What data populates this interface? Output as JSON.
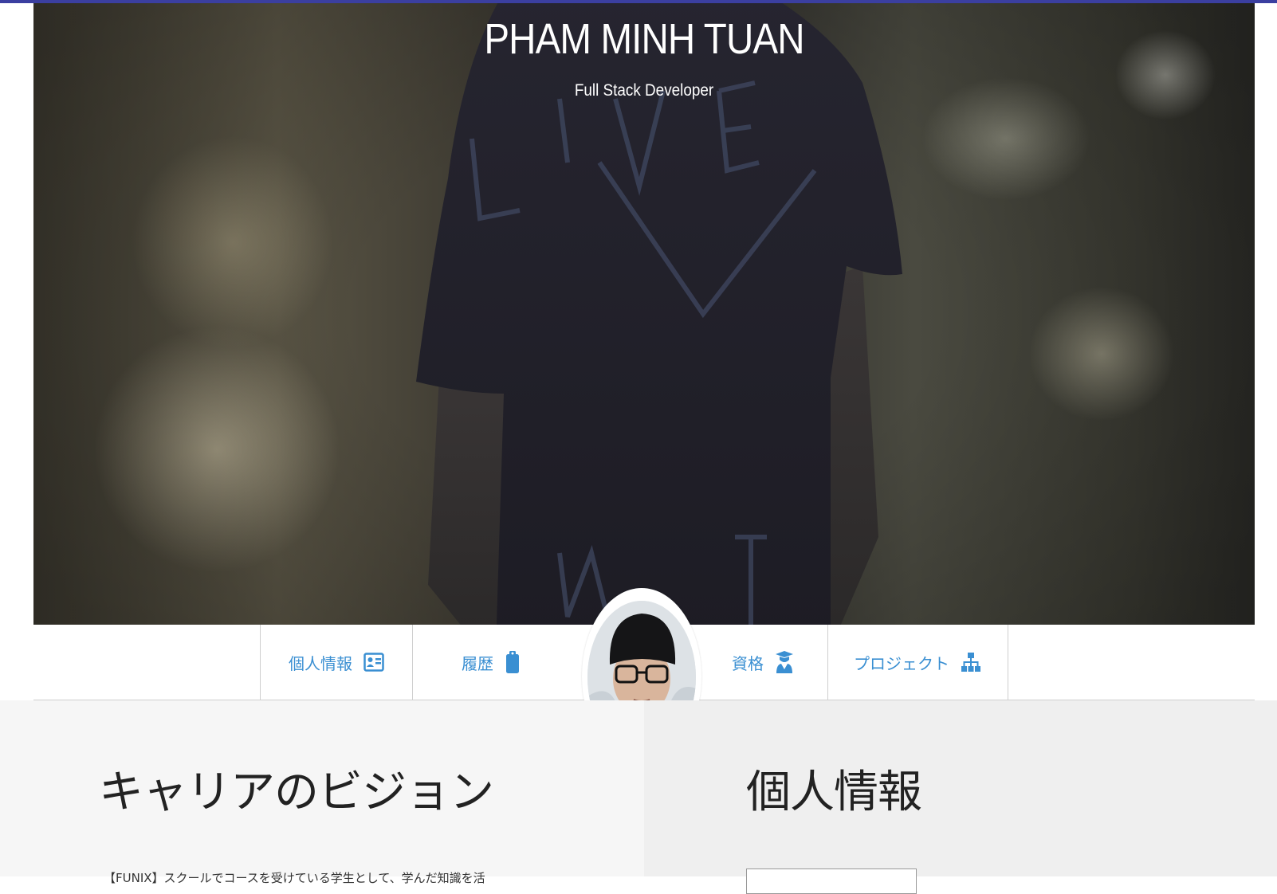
{
  "header": {
    "name": "PHAM MINH TUAN",
    "title": "Full Stack Developer"
  },
  "nav": {
    "items": [
      {
        "label": "個人情報",
        "icon": "id-card-icon"
      },
      {
        "label": "履歴",
        "icon": "clipboard-icon"
      },
      {
        "label": "資格",
        "icon": "graduate-icon"
      },
      {
        "label": "プロジェクト",
        "icon": "sitemap-icon"
      }
    ]
  },
  "sections": {
    "career": {
      "title": "キャリアのビジョン",
      "text": "【FUNIX】スクールでコースを受けている学生として、学んだ知識を活"
    },
    "personal": {
      "title": "個人情報"
    }
  },
  "colors": {
    "accent": "#3a8fd2",
    "topbar": "#3b3fa0",
    "left_panel": "#f6f6f6",
    "right_panel": "#efefef"
  }
}
